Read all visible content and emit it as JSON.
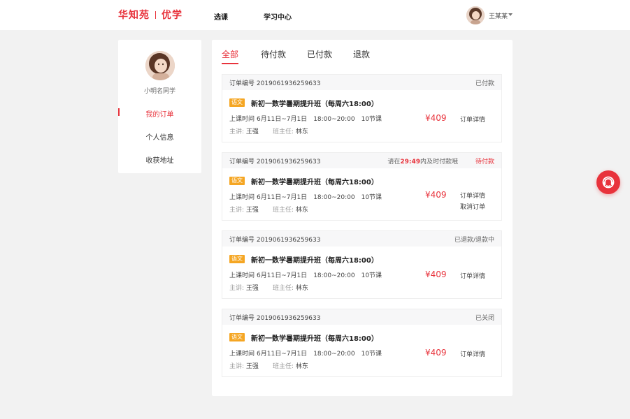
{
  "header": {
    "logo_left": "华知苑",
    "logo_right": "优学",
    "nav": [
      "选课",
      "学习中心"
    ],
    "user_name": "王某某"
  },
  "sidebar": {
    "username": "小明名同学",
    "items": [
      {
        "label": "我的订单",
        "active": true
      },
      {
        "label": "个人信息",
        "active": false
      },
      {
        "label": "收获地址",
        "active": false
      }
    ]
  },
  "tabs": [
    {
      "label": "全部",
      "active": true
    },
    {
      "label": "待付款",
      "active": false
    },
    {
      "label": "已付款",
      "active": false
    },
    {
      "label": "退款",
      "active": false
    }
  ],
  "orders": [
    {
      "order_no": "订单编号 2019061936259633",
      "status": "已付款",
      "tag": "语文",
      "title": "新初一数学暑期提升班（每周六18:00）",
      "time_label": "上课时间",
      "date_range": "6月11日~7月1日",
      "hours": "18:00~20:00",
      "lessons": "10节课",
      "teacher_label": "主讲:",
      "teacher": "王强",
      "class_teacher_label": "班主任:",
      "class_teacher": "林东",
      "price": "¥409",
      "actions": [
        "订单详情"
      ]
    },
    {
      "order_no": "订单编号 2019061936259633",
      "status": "待付款",
      "countdown_prefix": "请在",
      "countdown_time": "29:49",
      "countdown_suffix": "内及时付款哦",
      "tag": "语文",
      "title": "新初一数学暑期提升班（每周六18:00）",
      "time_label": "上课时间",
      "date_range": "6月11日~7月1日",
      "hours": "18:00~20:00",
      "lessons": "10节课",
      "teacher_label": "主讲:",
      "teacher": "王强",
      "class_teacher_label": "班主任:",
      "class_teacher": "林东",
      "price": "¥409",
      "actions": [
        "订单详情",
        "取消订单"
      ]
    },
    {
      "order_no": "订单编号 2019061936259633",
      "status": "已退款/退款中",
      "tag": "语文",
      "title": "新初一数学暑期提升班（每周六18:00）",
      "time_label": "上课时间",
      "date_range": "6月11日~7月1日",
      "hours": "18:00~20:00",
      "lessons": "10节课",
      "teacher_label": "主讲:",
      "teacher": "王强",
      "class_teacher_label": "班主任:",
      "class_teacher": "林东",
      "price": "¥409",
      "actions": [
        "订单详情"
      ]
    },
    {
      "order_no": "订单编号 2019061936259633",
      "status": "已关闭",
      "tag": "语文",
      "title": "新初一数学暑期提升班（每周六18:00）",
      "time_label": "上课时间",
      "date_range": "6月11日~7月1日",
      "hours": "18:00~20:00",
      "lessons": "10节课",
      "teacher_label": "主讲:",
      "teacher": "王强",
      "class_teacher_label": "班主任:",
      "class_teacher": "林东",
      "price": "¥409",
      "actions": [
        "订单详情"
      ]
    }
  ],
  "colors": {
    "accent": "#e8333c",
    "tag": "#f5a623"
  },
  "icons": {
    "service": "customer-service-icon",
    "caret": "chevron-down-icon"
  }
}
